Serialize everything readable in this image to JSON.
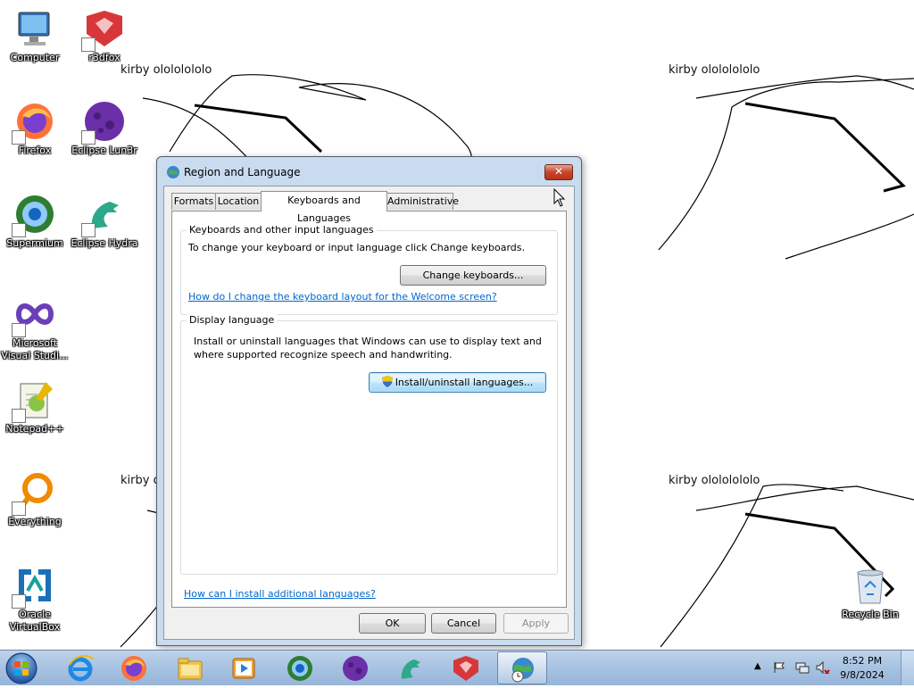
{
  "wallpaper": {
    "captions": [
      "kirby olololololo",
      "kirby olololololo",
      "kirby o",
      "kirby olololololo"
    ]
  },
  "desktop": {
    "icons": [
      {
        "label": "Computer",
        "icon": "computer-icon"
      },
      {
        "label": "r3dfox",
        "icon": "r3dfox-icon"
      },
      {
        "label": "Firefox",
        "icon": "firefox-icon"
      },
      {
        "label": "Eclipse Lun3r",
        "icon": "eclipse-lun3r-icon"
      },
      {
        "label": "Supermium",
        "icon": "supermium-icon"
      },
      {
        "label": "Eclipse Hydra",
        "icon": "eclipse-hydra-icon"
      },
      {
        "label": "Microsoft Visual Studi...",
        "icon": "visual-studio-icon"
      },
      {
        "label": "Notepad++",
        "icon": "notepadpp-icon"
      },
      {
        "label": "Everything",
        "icon": "everything-icon"
      },
      {
        "label": "Oracle VirtualBox",
        "icon": "virtualbox-icon"
      },
      {
        "label": "Recycle Bin",
        "icon": "recycle-bin-icon"
      }
    ]
  },
  "dialog": {
    "title": "Region and Language",
    "close_label": "✕",
    "tabs": [
      {
        "label": "Formats"
      },
      {
        "label": "Location"
      },
      {
        "label": "Keyboards and Languages",
        "active": true
      },
      {
        "label": "Administrative"
      }
    ],
    "keyboards_group": {
      "label": "Keyboards and other input languages",
      "description": "To change your keyboard or input language click Change keyboards.",
      "change_button": "Change keyboards...",
      "welcome_link": "How do I change the keyboard layout for the Welcome screen?"
    },
    "display_group": {
      "label": "Display language",
      "description_line1": "Install or uninstall languages that Windows can use to display text and",
      "description_line2": "where supported recognize speech and handwriting.",
      "install_button": "Install/uninstall languages..."
    },
    "help_link": "How can I install additional languages?",
    "buttons": {
      "ok": "OK",
      "cancel": "Cancel",
      "apply": "Apply"
    }
  },
  "taskbar": {
    "pinned": [
      "internet-explorer-icon",
      "firefox-icon",
      "file-explorer-icon",
      "media-player-icon",
      "supermium-icon",
      "eclipse-lun3r-icon",
      "eclipse-hydra-icon",
      "r3dfox-icon",
      "region-language-icon"
    ],
    "tray": {
      "time": "8:52 PM",
      "date": "9/8/2024"
    }
  }
}
